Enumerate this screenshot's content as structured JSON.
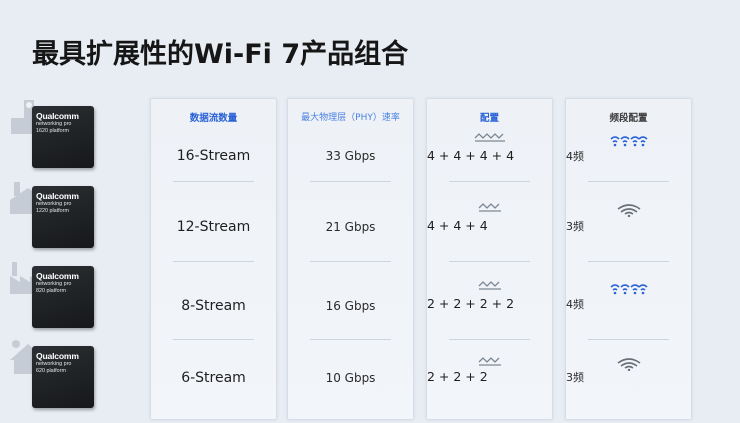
{
  "title": "最具扩展性的Wi-Fi 7产品组合",
  "chips": [
    {
      "brand": "Qualcomm",
      "line1": "networking pro",
      "line2": "1620 platform",
      "building": "house-icon"
    },
    {
      "brand": "Qualcomm",
      "line1": "networking pro",
      "line2": "1220 platform",
      "building": "warehouse-icon"
    },
    {
      "brand": "Qualcomm",
      "line1": "networking pro",
      "line2": "820 platform",
      "building": "factory-icon"
    },
    {
      "brand": "Qualcomm",
      "line1": "networking pro",
      "line2": "620 platform",
      "building": "home-icon"
    }
  ],
  "columns": {
    "streams": {
      "header": "数据流数量",
      "values": [
        "16-Stream",
        "12-Stream",
        "8-Stream",
        "6-Stream"
      ]
    },
    "phy": {
      "header": "最大物理层（PHY）速率",
      "values": [
        "33 Gbps",
        "21 Gbps",
        "16 Gbps",
        "10 Gbps"
      ]
    },
    "config": {
      "header": "配置",
      "values": [
        "4 + 4 + 4 + 4",
        "4 + 4 + 4",
        "2 + 2 + 2 + 2",
        "2 + 2 + 2"
      ]
    },
    "bands": {
      "header": "频段配置",
      "values": [
        "4频",
        "3频",
        "4频",
        "3频"
      ],
      "icons": [
        "wifi-4band-icon",
        "wifi-3band-icon",
        "wifi-4band-icon",
        "wifi-3band-icon"
      ]
    }
  },
  "colors": {
    "accent": "#2b63d6",
    "background": "#e8edf3",
    "chip": "#1c1e21"
  }
}
